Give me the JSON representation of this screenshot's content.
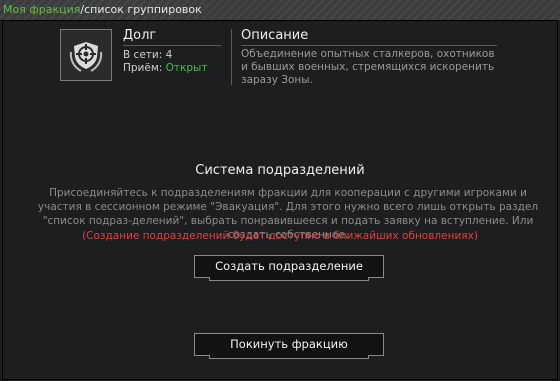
{
  "breadcrumb": {
    "active": "Моя фракция",
    "separator": "/",
    "current": "список группировок"
  },
  "faction": {
    "name": "Долг",
    "online_label": "В сети:",
    "online_count": "4",
    "recruitment_label": "Приём:",
    "recruitment_status": "Открыт",
    "emblem_icon": "shield-target-icon"
  },
  "description": {
    "title": "Описание",
    "text": "Объединение опытных сталкеров, охотников и бывших военных, стремящихся искоренить заразу Зоны."
  },
  "subdivisions": {
    "title": "Система подразделений",
    "info": "Присоединяйтесь к подразделениям фракции для кооперации с другими игроками и участия в сессионном режиме \"Эвакуация\". Для этого нужно всего лишь открыть раздел \"список подраз-делений\", выбрать понравившееся и подать заявку на вступление. Или создать собственное.",
    "warning": "(Создание подразделений будет доступно в ближайших обновлениях)",
    "create_button": "Создать подразделение"
  },
  "leave_button": "Покинуть фракцию",
  "colors": {
    "green": "#3fc23f",
    "warning": "#e04040",
    "background": "#1d1e1f"
  }
}
